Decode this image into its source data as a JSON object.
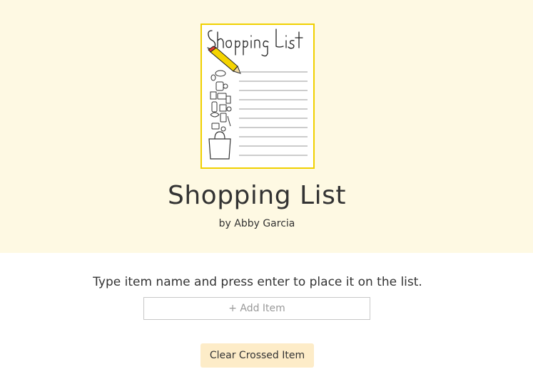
{
  "header": {
    "logo_text": "Shopping List",
    "title": "Shopping List",
    "byline": "by Abby Garcia"
  },
  "main": {
    "instructions": "Type item name and press enter to place it on the list.",
    "add_item": {
      "value": "",
      "placeholder": "+ Add Item"
    },
    "clear_button_label": "Clear Crossed Item"
  },
  "colors": {
    "hero_background": "#fef9e3",
    "logo_border": "#f0d000",
    "button_background": "#fdecc8",
    "pencil_body": "#f5d400",
    "pencil_eraser": "#e23b2e"
  },
  "icons": [
    "shopping-list-logo",
    "pencil-icon",
    "grocery-doodle-icon",
    "shopping-bag-icon"
  ]
}
